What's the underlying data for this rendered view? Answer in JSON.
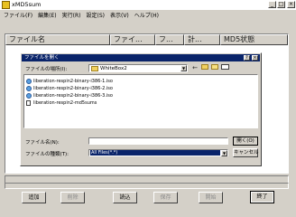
{
  "window": {
    "title": "xMD5sum"
  },
  "titlebar_buttons": {
    "minimize": "_",
    "maximize": "□",
    "close": "×"
  },
  "menu": [
    {
      "label": "ファイル(F)"
    },
    {
      "label": "編集(E)"
    },
    {
      "label": "実行(R)"
    },
    {
      "label": "設定(S)"
    },
    {
      "label": "表示(V)"
    },
    {
      "label": "ヘルプ(H)"
    }
  ],
  "list": {
    "columns": [
      "ファイル名",
      "ファイ...",
      "フ...",
      "計...",
      "MD5状態"
    ]
  },
  "buttons": {
    "add": "追加",
    "delete": "削除",
    "read": "読込",
    "save": "保存",
    "start": "開始",
    "close": "終了"
  },
  "dialog": {
    "title": "ファイルを開く",
    "help": "?",
    "close": "×",
    "lookin_label": "ファイルの場所(I):",
    "lookin_value": "WhiteBox2",
    "combo_arrow": "▼",
    "files": [
      "liberation-respin2-binary-i386-1.iso",
      "liberation-respin2-binary-i386-2.iso",
      "liberation-respin2-binary-i386-3.iso",
      "liberation-respin2-md5sums"
    ],
    "filename_label": "ファイル名(N):",
    "filename_value": "",
    "filetype_label": "ファイルの種類(T):",
    "filetype_value": "All Files(*.*)",
    "open_button": "開く(O)",
    "cancel_button": "キャンセル"
  },
  "colors": {
    "dialog_title_bg": "#0a246a",
    "selection": "#0a246a",
    "face": "#d4d0c8"
  }
}
